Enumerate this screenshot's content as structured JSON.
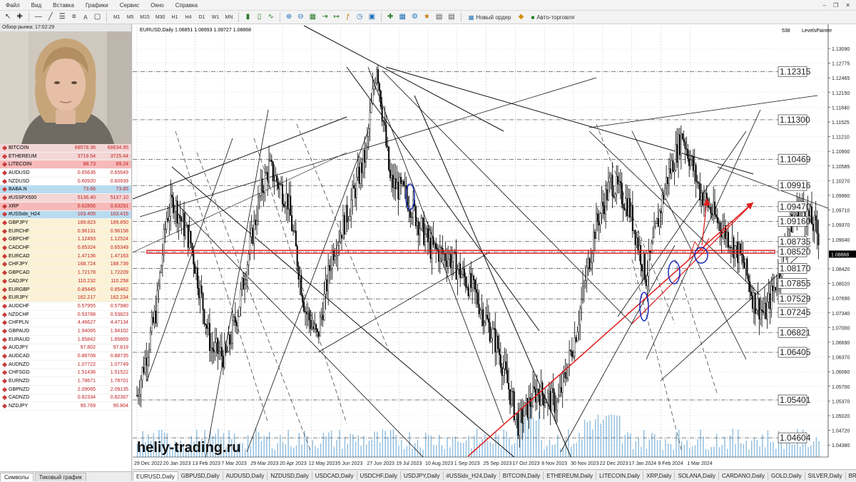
{
  "menu": [
    "Файл",
    "Вид",
    "Вставка",
    "Графики",
    "Сервис",
    "Окно",
    "Справка"
  ],
  "toolbar": {
    "timeframes": [
      "M1",
      "M5",
      "M15",
      "M30",
      "H1",
      "H4",
      "D1",
      "W1",
      "MN"
    ],
    "new_order": "Новый ордер",
    "auto_trading": "Авто-торговля"
  },
  "market_watch": {
    "title": "Обзор рынка: 17:02:29",
    "symbols": [
      {
        "name": "BITCOIN",
        "bid": "68578.36",
        "ask": "68634.95",
        "bg": "#f3d6d6"
      },
      {
        "name": "ETHEREUM",
        "bid": "3719.54",
        "ask": "3725.44",
        "bg": "#f3d6d6"
      },
      {
        "name": "LITECOIN",
        "bid": "88.73",
        "ask": "89.24",
        "bg": "#f7b9b9"
      },
      {
        "name": "AUDUSD",
        "bid": "0.65636",
        "ask": "0.65649",
        "bg": "#ffffff"
      },
      {
        "name": "NZDUSD",
        "bid": "0.60920",
        "ask": "0.60939",
        "bg": "#ffffff"
      },
      {
        "name": "BABA.N",
        "bid": "73.66",
        "ask": "73.85",
        "bg": "#b9dbf0"
      },
      {
        "name": "#USSPX500",
        "bid": "5136.40",
        "ask": "5137.10",
        "bg": "#f3d6d6"
      },
      {
        "name": "XRP",
        "bid": "0.62856",
        "ask": "0.63291",
        "bg": "#f7b9b9"
      },
      {
        "name": "#USSidx_H24",
        "bid": "103.405",
        "ask": "103.415",
        "bg": "#b9dbf0"
      },
      {
        "name": "GBPJPY",
        "bid": "189.823",
        "ask": "189.850",
        "bg": "#fbf2d6"
      },
      {
        "name": "EURCHF",
        "bid": "0.96131",
        "ask": "0.96158",
        "bg": "#fbf2d6"
      },
      {
        "name": "GBPCHF",
        "bid": "1.12493",
        "ask": "1.12524",
        "bg": "#fbf2d6"
      },
      {
        "name": "CADCHF",
        "bid": "0.65324",
        "ask": "0.65349",
        "bg": "#fbf2d6"
      },
      {
        "name": "EURCAD",
        "bid": "1.47136",
        "ask": "1.47163",
        "bg": "#fbf2d6"
      },
      {
        "name": "CHFJPY",
        "bid": "168.724",
        "ask": "168.739",
        "bg": "#fbf2d6"
      },
      {
        "name": "GBPCAD",
        "bid": "1.72178",
        "ask": "1.72209",
        "bg": "#fbf2d6"
      },
      {
        "name": "CADJPY",
        "bid": "110.232",
        "ask": "110.258",
        "bg": "#fbf2d6"
      },
      {
        "name": "EURGBP",
        "bid": "0.85445",
        "ask": "0.85462",
        "bg": "#fbf2d6"
      },
      {
        "name": "EURJPY",
        "bid": "162.217",
        "ask": "162.234",
        "bg": "#fbf2d6"
      },
      {
        "name": "AUDCHF",
        "bid": "0.57955",
        "ask": "0.57980",
        "bg": "#ffffff"
      },
      {
        "name": "NZDCHF",
        "bid": "0.53788",
        "ask": "0.53823",
        "bg": "#ffffff"
      },
      {
        "name": "CHFPLN",
        "bid": "4.46627",
        "ask": "4.47134",
        "bg": "#ffffff"
      },
      {
        "name": "GBPAUD",
        "bid": "1.94065",
        "ask": "1.94102",
        "bg": "#ffffff"
      },
      {
        "name": "EURAUD",
        "bid": "1.65842",
        "ask": "1.65869",
        "bg": "#ffffff"
      },
      {
        "name": "AUDJPY",
        "bid": "97.802",
        "ask": "97.819",
        "bg": "#ffffff"
      },
      {
        "name": "AUDCAD",
        "bid": "0.88708",
        "ask": "0.88735",
        "bg": "#ffffff"
      },
      {
        "name": "AUDNZD",
        "bid": "1.07722",
        "ask": "1.07749",
        "bg": "#ffffff"
      },
      {
        "name": "CHFSGD",
        "bid": "1.51436",
        "ask": "1.51522",
        "bg": "#ffffff"
      },
      {
        "name": "EURNZD",
        "bid": "1.78671",
        "ask": "1.78701",
        "bg": "#ffffff"
      },
      {
        "name": "GBPNZD",
        "bid": "2.09065",
        "ask": "2.09135",
        "bg": "#ffffff"
      },
      {
        "name": "CADNZD",
        "bid": "0.82334",
        "ask": "0.82367",
        "bg": "#ffffff"
      },
      {
        "name": "NZDJPY",
        "bid": "90.769",
        "ask": "90.804",
        "bg": "#ffffff"
      }
    ],
    "tabs": [
      "Символы",
      "Тиковый график"
    ]
  },
  "chart": {
    "header": "EURUSD,Daily  1.08851 1.08993 1.08727 1.08868",
    "indicator_name": "LevelsPainter",
    "bar_count": "538",
    "watermark": "heliy-trading.ru",
    "current_price": "1.08868",
    "y_ticks": [
      "1.13090",
      "1.12775",
      "1.12465",
      "1.12150",
      "1.11840",
      "1.11525",
      "1.11210",
      "1.10900",
      "1.10585",
      "1.10270",
      "1.09960",
      "1.09710",
      "1.09370",
      "1.09040",
      "1.08868",
      "1.08420",
      "1.08020",
      "1.07690",
      "1.07340",
      "1.07000",
      "1.06690",
      "1.06370",
      "1.06060",
      "1.05700",
      "1.05370",
      "1.05020",
      "1.04720",
      "1.04380",
      "1.04060"
    ],
    "x_ticks": [
      "29 Dec 2022",
      "20 Jan 2023",
      "13 Feb 2023",
      "7 Mar 2023",
      "29 Mar 2023",
      "20 Apr 2023",
      "12 May 2023",
      "5 Jun 2023",
      "27 Jun 2023",
      "19 Jul 2023",
      "10 Aug 2023",
      "1 Sep 2023",
      "25 Sep 2023",
      "17 Oct 2023",
      "8 Nov 2023",
      "30 Nov 2023",
      "22 Dec 2023",
      "17 Jan 2024",
      "8 Feb 2024",
      "1 Mar 2024"
    ],
    "levels": [
      "1.12315",
      "1.11300",
      "1.10469",
      "1.09916",
      "1.09470",
      "1.09160",
      "1.08735",
      "1.08520",
      "1.08170",
      "1.07855",
      "1.07529",
      "1.07245",
      "1.06821",
      "1.06405",
      "1.05401",
      "1.04604"
    ],
    "chart_data": {
      "type": "candlestick",
      "symbol": "EURUSD",
      "timeframe": "Daily",
      "ohlc_last": {
        "open": 1.08851,
        "high": 1.08993,
        "low": 1.08727,
        "close": 1.08868
      },
      "key_level": 1.0852,
      "path": [
        [
          0,
          1.055
        ],
        [
          14,
          1.0725
        ],
        [
          22,
          1.0925
        ],
        [
          27,
          1.096
        ],
        [
          40,
          1.087
        ],
        [
          55,
          1.065
        ],
        [
          66,
          1.063
        ],
        [
          75,
          1.073
        ],
        [
          92,
          1.098
        ],
        [
          98,
          1.103
        ],
        [
          112,
          1.096
        ],
        [
          125,
          1.073
        ],
        [
          134,
          1.067
        ],
        [
          145,
          1.085
        ],
        [
          156,
          1.093
        ],
        [
          170,
          1.106
        ],
        [
          178,
          1.125
        ],
        [
          188,
          1.1
        ],
        [
          200,
          1.097
        ],
        [
          218,
          1.086
        ],
        [
          232,
          1.084
        ],
        [
          250,
          1.077
        ],
        [
          268,
          1.065
        ],
        [
          283,
          1.049
        ],
        [
          297,
          1.056
        ],
        [
          312,
          1.053
        ],
        [
          325,
          1.067
        ],
        [
          340,
          1.09
        ],
        [
          352,
          1.1
        ],
        [
          365,
          1.095
        ],
        [
          378,
          1.08
        ],
        [
          393,
          1.1
        ],
        [
          405,
          1.11
        ],
        [
          418,
          1.098
        ],
        [
          430,
          1.092
        ],
        [
          440,
          1.088
        ],
        [
          450,
          1.083
        ],
        [
          458,
          1.075
        ],
        [
          466,
          1.072
        ],
        [
          476,
          1.08
        ],
        [
          484,
          1.09
        ],
        [
          492,
          1.095
        ],
        [
          500,
          1.092
        ],
        [
          506,
          1.0887
        ]
      ],
      "volume_profile": "histogram"
    }
  },
  "chart_tabs": [
    "EURUSD,Daily",
    "GBPUSD,Daily",
    "AUDUSD,Daily",
    "NZDUSD,Daily",
    "USDCAD,Daily",
    "USDCHF,Daily",
    "USDJPY,Daily",
    "#USSidx_H24,Daily",
    "BITCOIN,Daily",
    "ETHEREUM,Daily",
    "LITECOIN,Daily",
    "XRP,Daily",
    "SOLANA,Daily",
    "CARDANO,Daily",
    "GOLD,Daily",
    "SILVER,Daily",
    "BRENT,Daily"
  ],
  "colors": {
    "red_line": "#e21b1b",
    "oval": "#1b2bb8",
    "grid": "#c9c9c9"
  }
}
